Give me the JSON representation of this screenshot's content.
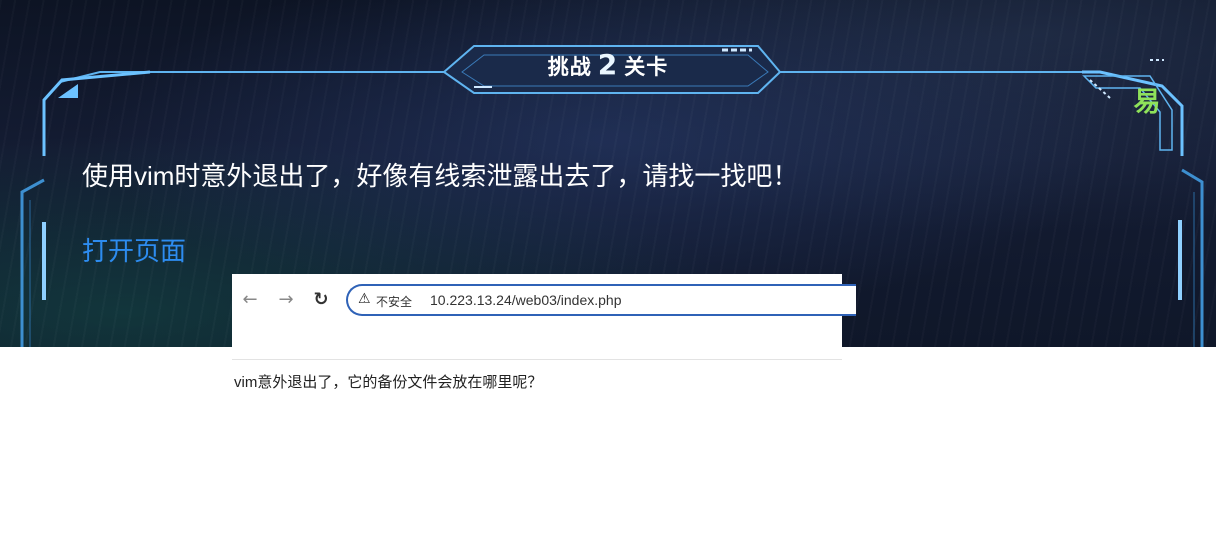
{
  "challenge": {
    "title_prefix": "挑战",
    "title_number": "2",
    "title_suffix": "关卡",
    "difficulty": "易",
    "task_text": "使用vim时意外退出了，好像有线索泄露出去了，请找一找吧！",
    "open_link": "打开页面"
  },
  "browser": {
    "back_icon": "arrow-left-icon",
    "forward_icon": "arrow-right-icon",
    "reload_icon": "reload-icon",
    "security_label": "不安全",
    "url": "10.223.13.24/web03/index.php",
    "page_text": "vim意外退出了，它的备份文件会放在哪里呢？"
  },
  "colors": {
    "hud_bg": "#141c33",
    "frame_line": "#5fb4f0",
    "link": "#2d8cf0",
    "difficulty": "#8fe25a",
    "address_border": "#2f62b7"
  }
}
